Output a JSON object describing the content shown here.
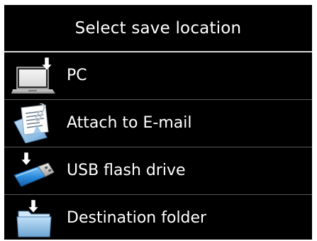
{
  "header": {
    "title": "Select save location"
  },
  "menu": {
    "items": [
      {
        "label": "PC",
        "icon": "laptop-icon"
      },
      {
        "label": "Attach to E-mail",
        "icon": "email-attachment-icon"
      },
      {
        "label": "USB flash drive",
        "icon": "usb-drive-icon"
      },
      {
        "label": "Destination folder",
        "icon": "folder-icon"
      }
    ]
  },
  "colors": {
    "background": "#000000",
    "text": "#ffffff",
    "divider": "#d8d8d8"
  }
}
